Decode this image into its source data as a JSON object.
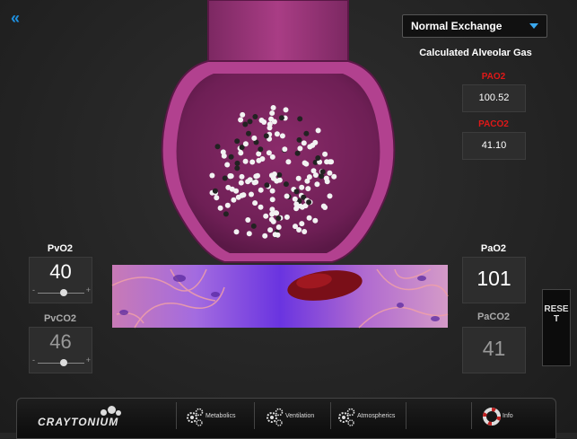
{
  "nav": {
    "back_icon": "double-chevron-left-icon",
    "back_glyph": "«"
  },
  "mode_select": {
    "selected": "Normal Exchange"
  },
  "alveolar": {
    "title": "Calculated Alveolar Gas",
    "pao2_label": "PAO2",
    "pao2_value": "100.52",
    "paco2_label": "PACO2",
    "paco2_value": "41.10"
  },
  "venous": {
    "pvo2_label": "PvO2",
    "pvo2_value": "40",
    "pvo2_slider_fraction": 0.55,
    "pvco2_label": "PvCO2",
    "pvco2_value": "46",
    "pvco2_slider_fraction": 0.55,
    "minus": "-",
    "plus": "+"
  },
  "arterial": {
    "pao2_label": "PaO2",
    "pao2_value": "101",
    "paco2_label": "PaCO2",
    "paco2_value": "41"
  },
  "reset_label": "RESET",
  "bottom_bar": {
    "logo_text": "CRAYTONIUM",
    "items": [
      {
        "label": "Metabolics",
        "icon": "gears-icon"
      },
      {
        "label": "Ventilation",
        "icon": "gears-icon"
      },
      {
        "label": "Atmospherics",
        "icon": "gears-icon"
      },
      {
        "label": "Info",
        "icon": "lifebuoy-icon"
      }
    ]
  },
  "colors": {
    "accent_blue": "#1e90e0",
    "alert_red": "#e01818",
    "alveolus_pink": "#9a2f74",
    "capillary_purple": "#6a34e0"
  }
}
